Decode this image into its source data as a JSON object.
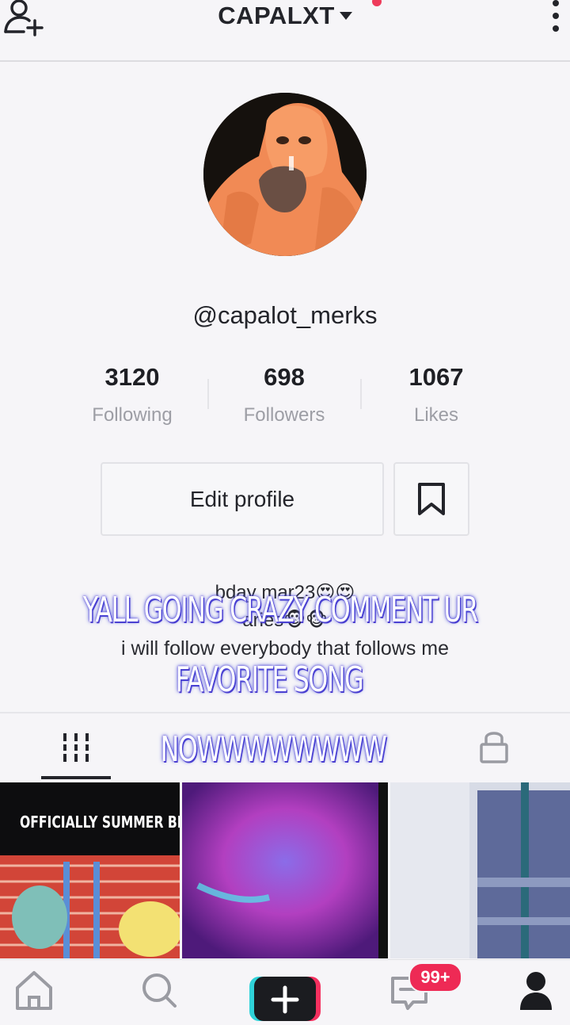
{
  "header": {
    "title": "CAPALXT"
  },
  "profile": {
    "username": "@capalot_merks",
    "stats": [
      {
        "value": "3120",
        "label": "Following"
      },
      {
        "value": "698",
        "label": "Followers"
      },
      {
        "value": "1067",
        "label": "Likes"
      }
    ],
    "edit_profile_label": "Edit profile",
    "bio": {
      "line1": "bday mar23😍😍",
      "line2": "aries🐵🐵",
      "line3": "i will follow everybody that follows me"
    }
  },
  "overlay_caption": {
    "line1": "YALL GOING CRAZY COMMENT UR",
    "line2": "FAVORITE SONG",
    "line3": "NOWWWWWWWW"
  },
  "videos": {
    "items": [
      {
        "caption": "OFFICIALLY SUMMER BREAK"
      },
      {
        "caption": ""
      },
      {
        "caption": ""
      }
    ]
  },
  "bottom_nav": {
    "inbox_badge": "99+"
  },
  "colors": {
    "accent_red": "#ee2a55",
    "plus_cyan": "#2fd2d8",
    "plus_pink": "#f5305f"
  }
}
